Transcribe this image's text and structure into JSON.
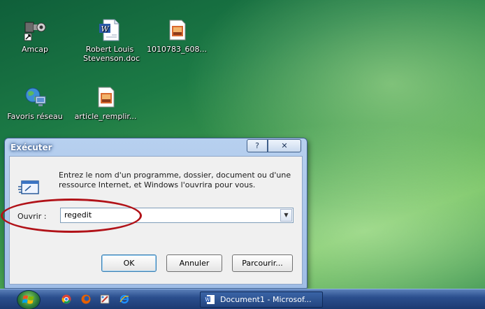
{
  "desktop": {
    "icons": [
      {
        "label": "Amcap",
        "icon": "webcam-app-icon"
      },
      {
        "label": "Robert Louis Stevenson.doc",
        "icon": "word-document-icon"
      },
      {
        "label": "1010783_608...",
        "icon": "image-file-icon"
      },
      {
        "label": "Favoris réseau",
        "icon": "network-places-icon"
      },
      {
        "label": "article_remplir...",
        "icon": "image-file-icon"
      }
    ]
  },
  "run_dialog": {
    "title": "Exécuter",
    "help_label": "?",
    "close_label": "✕",
    "description": "Entrez le nom d'un programme, dossier, document ou d'une ressource Internet, et Windows l'ouvrira pour vous.",
    "open_label": "Ouvrir :",
    "open_value": "regedit",
    "ok_label": "OK",
    "cancel_label": "Annuler",
    "browse_label": "Parcourir...",
    "highlight_color": "#b11218"
  },
  "taskbar": {
    "task_label": "Document1 - Microsof...",
    "quick_launch": [
      "chrome-icon",
      "firefox-icon",
      "paint-icon",
      "ie-icon"
    ]
  },
  "colors": {
    "taskbar": "#1c3a72",
    "dialog_frame": "#b7d0ef"
  }
}
